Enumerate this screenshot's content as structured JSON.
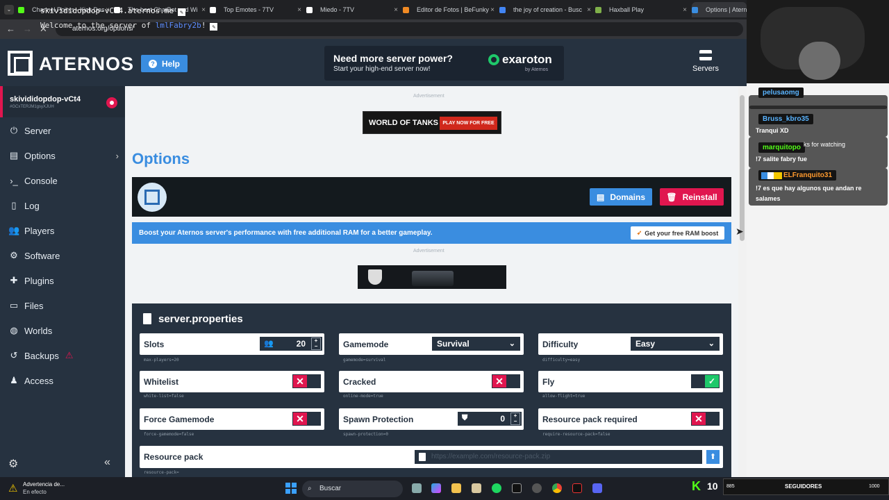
{
  "browser": {
    "tabs": [
      {
        "title": "Channel Points - Kick Das",
        "color": "#53fc18"
      },
      {
        "title": "The best ChatBot and Wi",
        "color": "#ffffff"
      },
      {
        "title": "Top Emotes - 7TV",
        "color": "#ffffff"
      },
      {
        "title": "Miedo - 7TV",
        "color": "#ffffff"
      },
      {
        "title": "Editor de Fotos | BeFunky",
        "color": "#f08a24"
      },
      {
        "title": "the joy of creation - Busc",
        "color": "#4285f4"
      },
      {
        "title": "Haxball Play",
        "color": "#7fb04a"
      },
      {
        "title": "Options | Aterno",
        "color": "#3a8de0"
      }
    ],
    "url": "aternos.org/options/"
  },
  "header": {
    "logo": "ATERNOS",
    "help": "Help",
    "promo_title": "Need more server power?",
    "promo_sub": "Start your high-end server now!",
    "promo_brand": "exaroton",
    "promo_by": "by Aternos",
    "servers": "Servers"
  },
  "server": {
    "name": "skivididopdop-vCt4",
    "id": "#GCxTERJM1gsyXJUH"
  },
  "sidebar": {
    "items": [
      {
        "label": "Server",
        "icon": "power-icon"
      },
      {
        "label": "Options",
        "icon": "sliders-icon"
      },
      {
        "label": "Console",
        "icon": "terminal-icon"
      },
      {
        "label": "Log",
        "icon": "file-icon"
      },
      {
        "label": "Players",
        "icon": "users-icon"
      },
      {
        "label": "Software",
        "icon": "cogs-icon"
      },
      {
        "label": "Plugins",
        "icon": "puzzle-icon"
      },
      {
        "label": "Files",
        "icon": "folder-icon"
      },
      {
        "label": "Worlds",
        "icon": "globe-icon"
      },
      {
        "label": "Backups",
        "icon": "history-icon"
      },
      {
        "label": "Access",
        "icon": "user-icon"
      }
    ]
  },
  "ads": {
    "label": "Advertisement",
    "ad1_title": "WORLD OF TANKS",
    "ad1_button": "PLAY NOW FOR FREE"
  },
  "page": {
    "title": "Options"
  },
  "banner": {
    "address": "skivididopdop-vCt4.aternos.me",
    "welcome_prefix": "Welcome to the server of ",
    "owner": "lmlFabry2b",
    "welcome_suffix": "!",
    "domains": "Domains",
    "reinstall": "Reinstall"
  },
  "boost": {
    "text": "Boost your Aternos server's performance with free additional RAM for a better gameplay.",
    "button": "Get your free RAM boost"
  },
  "props": {
    "title": "server.properties",
    "slots": {
      "label": "Slots",
      "value": "20",
      "sub": "max-players=20"
    },
    "gamemode": {
      "label": "Gamemode",
      "value": "Survival",
      "sub": "gamemode=survival"
    },
    "difficulty": {
      "label": "Difficulty",
      "value": "Easy",
      "sub": "difficulty=easy"
    },
    "whitelist": {
      "label": "Whitelist",
      "sub": "white-list=false"
    },
    "cracked": {
      "label": "Cracked",
      "sub": "online-mode=true"
    },
    "fly": {
      "label": "Fly",
      "sub": "allow-flight=true"
    },
    "forcegm": {
      "label": "Force Gamemode",
      "sub": "force-gamemode=false"
    },
    "spawn": {
      "label": "Spawn Protection",
      "value": "0",
      "sub": "spawn-protection=0"
    },
    "rpreq": {
      "label": "Resource pack required",
      "sub": "require-resource-pack=false"
    },
    "rp": {
      "label": "Resource pack",
      "placeholder": "https://example.com/resource-pack.zip",
      "sub": "resource-pack="
    }
  },
  "chat": [
    {
      "nick": "pelusaomg",
      "color": "#5ab4ff",
      "text": ""
    },
    {
      "nick": "Bruss_kbro35",
      "color": "#5ab4ff",
      "text": "Tranqui XD"
    },
    {
      "nick": "marquitopo",
      "color": "#53fc18",
      "text": "!7 salite fabry fue"
    },
    {
      "nick": "ELFranquito31",
      "color": "#ff9a2e",
      "text": "!7 es que hay algunos que andan re salames"
    }
  ],
  "chat_fragment": "ks for watching",
  "taskbar": {
    "alert_title": "Advertencia de...",
    "alert_sub": "En efecto",
    "search": "Buscar",
    "kick_count": "10",
    "follows_start": "885",
    "follows_label": "SEGUIDORES",
    "follows_goal": "1000"
  }
}
